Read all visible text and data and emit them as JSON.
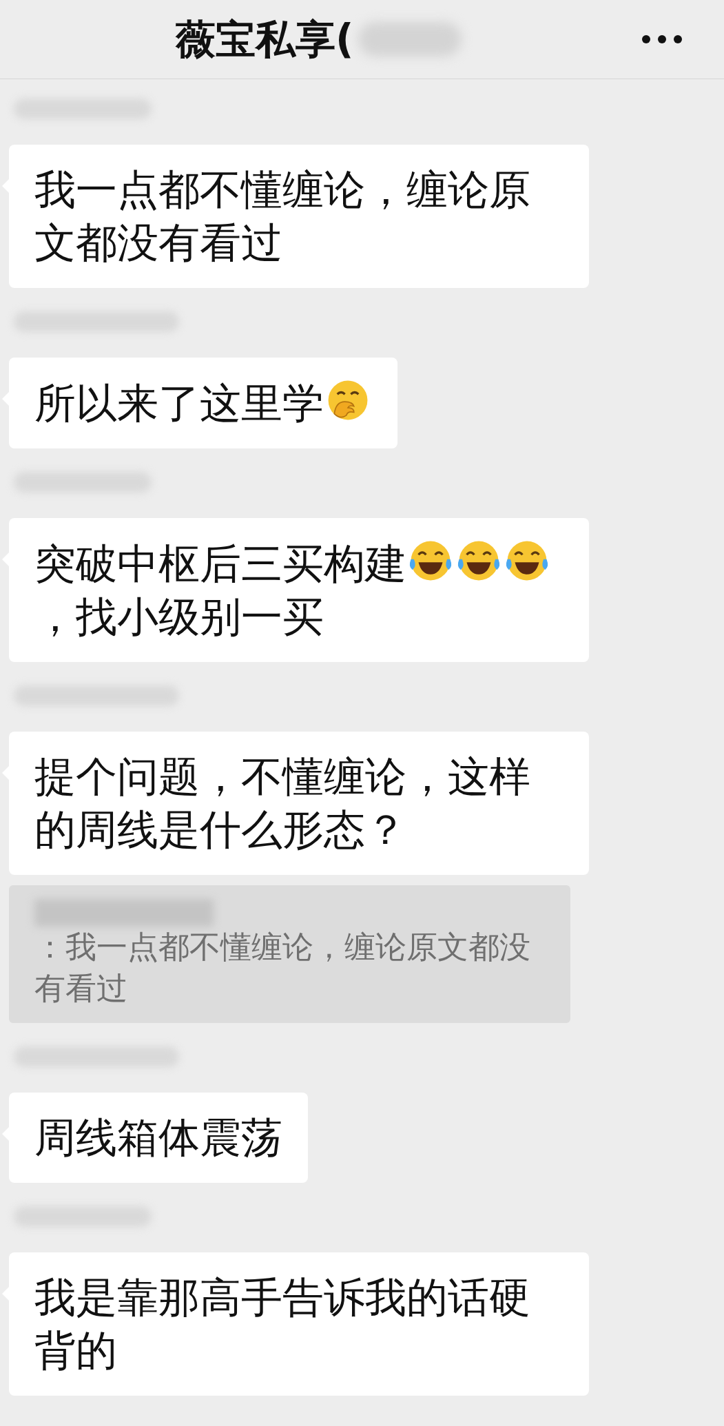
{
  "header": {
    "title": "薇宝私享("
  },
  "messages": [
    {
      "kind": "bubble",
      "parts": [
        {
          "kind": "text",
          "text": "我一点都不懂缠论，缠论原文都没有看过"
        }
      ]
    },
    {
      "kind": "bubble",
      "parts": [
        {
          "kind": "text",
          "text": "所以来了这里学"
        },
        {
          "kind": "hand-emoji"
        }
      ]
    },
    {
      "kind": "bubble",
      "parts": [
        {
          "kind": "text",
          "text": "突破中枢后三买构建"
        },
        {
          "kind": "laugh-emoji"
        },
        {
          "kind": "laugh-emoji"
        },
        {
          "kind": "laugh-emoji"
        },
        {
          "kind": "text",
          "text": "，找小级别一买"
        }
      ]
    },
    {
      "kind": "bubble",
      "parts": [
        {
          "kind": "text",
          "text": "提个问题，不懂缠论，这样的周线是什么形态？"
        }
      ]
    },
    {
      "kind": "quote",
      "parts": [
        {
          "kind": "text",
          "text": "：我一点都不懂缠论，缠论原文都没有看过"
        }
      ]
    },
    {
      "kind": "bubble",
      "parts": [
        {
          "kind": "text",
          "text": "周线箱体震荡"
        }
      ]
    },
    {
      "kind": "bubble",
      "parts": [
        {
          "kind": "text",
          "text": "我是靠那高手告诉我的话硬背的"
        }
      ]
    }
  ]
}
